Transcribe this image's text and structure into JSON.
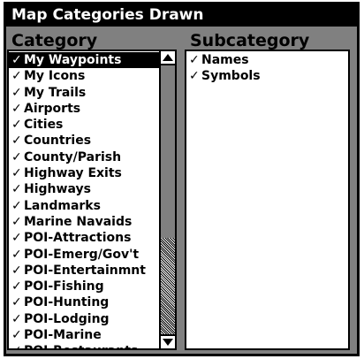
{
  "window": {
    "title": "Map Categories Drawn"
  },
  "category": {
    "header": "Category",
    "check_glyph": "✓",
    "items": [
      {
        "label": "My Waypoints",
        "checked": true,
        "selected": true
      },
      {
        "label": "My Icons",
        "checked": true
      },
      {
        "label": "My Trails",
        "checked": true
      },
      {
        "label": "Airports",
        "checked": true
      },
      {
        "label": "Cities",
        "checked": true
      },
      {
        "label": "Countries",
        "checked": true
      },
      {
        "label": "County/Parish",
        "checked": true
      },
      {
        "label": "Highway Exits",
        "checked": true
      },
      {
        "label": "Highways",
        "checked": true
      },
      {
        "label": "Landmarks",
        "checked": true
      },
      {
        "label": "Marine Navaids",
        "checked": true
      },
      {
        "label": "POI-Attractions",
        "checked": true
      },
      {
        "label": "POI-Emerg/Gov't",
        "checked": true
      },
      {
        "label": "POI-Entertainmnt",
        "checked": true
      },
      {
        "label": "POI-Fishing",
        "checked": true
      },
      {
        "label": "POI-Hunting",
        "checked": true
      },
      {
        "label": "POI-Lodging",
        "checked": true
      },
      {
        "label": "POI-Marine",
        "checked": true
      },
      {
        "label": "POI-Restaurants",
        "checked": true
      }
    ],
    "scroll": {
      "thumb_start": 0.0,
      "thumb_fraction": 0.64
    }
  },
  "subcategory": {
    "header": "Subcategory",
    "check_glyph": "✓",
    "items": [
      {
        "label": "Names",
        "checked": true
      },
      {
        "label": "Symbols",
        "checked": true
      }
    ]
  }
}
